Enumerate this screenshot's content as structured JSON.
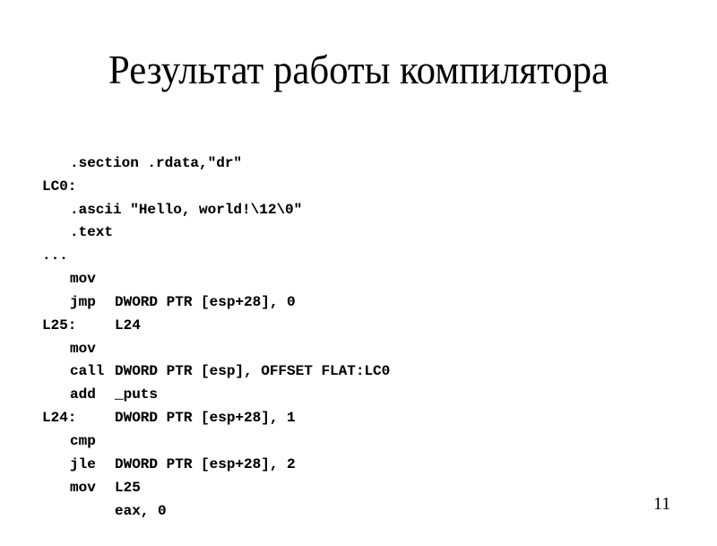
{
  "slide": {
    "title": "Результат работы компилятора",
    "number": "11"
  },
  "code": {
    "lines": [
      {
        "type": "directive",
        "text": ".section .rdata,\"dr\""
      },
      {
        "type": "label",
        "text": "LC0:"
      },
      {
        "type": "directive",
        "text": ".ascii \"Hello, world!\\12\\0\""
      },
      {
        "type": "directive",
        "text": ".text"
      },
      {
        "type": "label",
        "text": "..."
      },
      {
        "type": "instruction",
        "mnemonic": "mov",
        "operands": "DWORD PTR [esp+28], 0"
      },
      {
        "type": "instruction",
        "mnemonic": "jmp",
        "operands": "L24"
      },
      {
        "type": "label",
        "text": "L25:"
      },
      {
        "type": "instruction",
        "mnemonic": "mov",
        "operands": "DWORD PTR [esp], OFFSET FLAT:LC0"
      },
      {
        "type": "instruction",
        "mnemonic": "call",
        "operands": "_puts"
      },
      {
        "type": "instruction",
        "mnemonic": "add",
        "operands": "DWORD PTR [esp+28], 1"
      },
      {
        "type": "label",
        "text": "L24:"
      },
      {
        "type": "instruction",
        "mnemonic": "cmp",
        "operands": "DWORD PTR [esp+28], 2"
      },
      {
        "type": "instruction",
        "mnemonic": "jle",
        "operands": "L25"
      },
      {
        "type": "instruction",
        "mnemonic": "mov",
        "operands": "eax, 0"
      }
    ]
  }
}
